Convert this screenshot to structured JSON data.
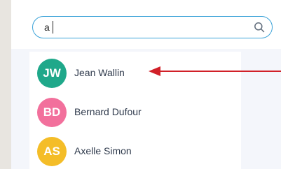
{
  "search": {
    "value": "a"
  },
  "contacts": [
    {
      "initials": "JW",
      "name": "Jean Wallin",
      "color": "#1fa88a"
    },
    {
      "initials": "BD",
      "name": "Bernard Dufour",
      "color": "#f2709c"
    },
    {
      "initials": "AS",
      "name": "Axelle Simon",
      "color": "#f4bd28"
    }
  ],
  "annotation": {
    "color": "#d12028",
    "icon": "arrow-left-icon"
  }
}
